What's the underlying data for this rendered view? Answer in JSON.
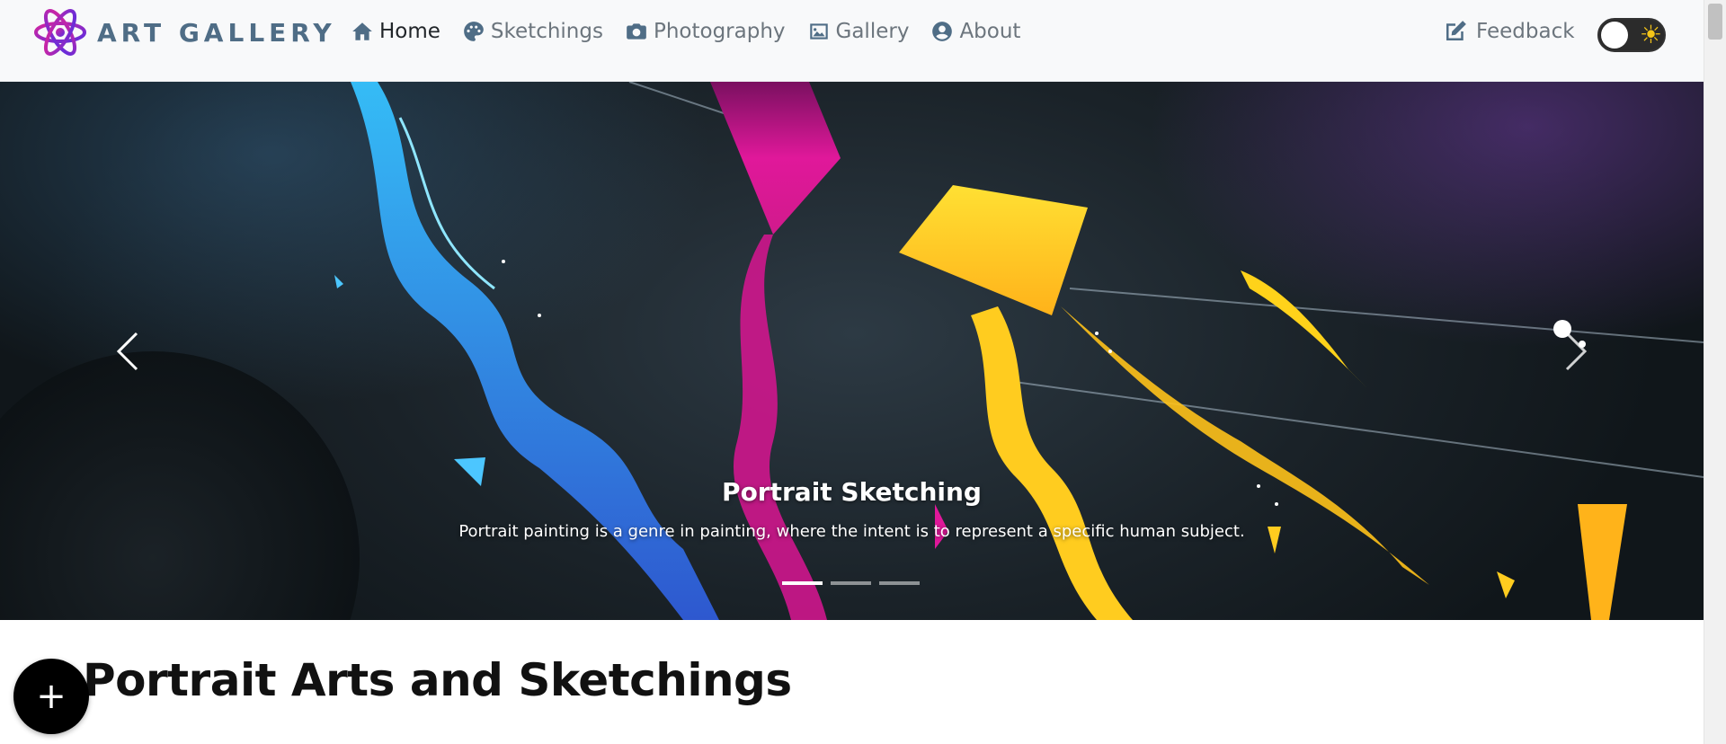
{
  "navbar": {
    "brand": "ART GALLERY",
    "links": [
      {
        "label": "Home",
        "icon": "home-icon"
      },
      {
        "label": "Sketchings",
        "icon": "palette-icon"
      },
      {
        "label": "Photography",
        "icon": "camera-icon"
      },
      {
        "label": "Gallery",
        "icon": "image-icon"
      },
      {
        "label": "About",
        "icon": "user-circle-icon"
      }
    ],
    "feedback_label": "Feedback",
    "theme_toggle_icon": "sun-icon"
  },
  "carousel": {
    "slides": 3,
    "active_slide": 1,
    "caption_title": "Portrait Sketching",
    "caption_text": "Portrait painting is a genre in painting, where the intent is to represent a specific human subject."
  },
  "section": {
    "title": "Portrait Arts and Sketchings"
  },
  "fab_label": "+",
  "colors": {
    "accent": "#4f6d86",
    "navbar_bg": "#f8f9fa",
    "kite_blue": "#2fb4f0",
    "kite_magenta": "#e0189a",
    "kite_yellow": "#ffd21a"
  }
}
